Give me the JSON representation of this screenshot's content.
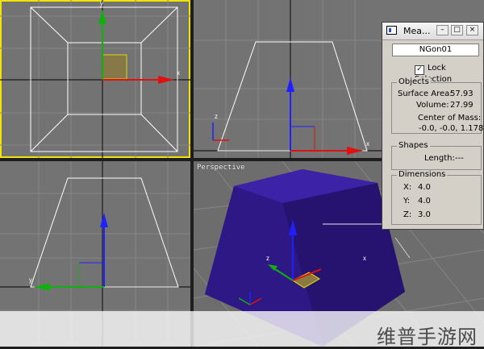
{
  "viewports": {
    "top": {
      "axis_x": "x",
      "axis_y": "y"
    },
    "front": {
      "axis_z": "z",
      "axis_x": "x"
    },
    "left": {
      "axis_y": "y"
    },
    "perspective": {
      "label": "Perspective",
      "axis_z": "z",
      "axis_y": "y",
      "axis_x": "x"
    }
  },
  "measure_dialog": {
    "title": "Mea...",
    "object_name": "NGon01",
    "lock_selection_label": "Lock Selection",
    "lock_selection_checked": true,
    "objects_group": {
      "title": "Objects",
      "surface_area_label": "Surface Area:",
      "surface_area_value": "57.93",
      "volume_label": "Volume:",
      "volume_value": "27.99",
      "center_of_mass_label": "Center of Mass:",
      "center_of_mass_value": "-0.0, -0.0, 1.178"
    },
    "shapes_group": {
      "title": "Shapes",
      "length_label": "Length:",
      "length_value": "---"
    },
    "dimensions_group": {
      "title": "Dimensions",
      "x_label": "X:",
      "x_value": "4.0",
      "y_label": "Y:",
      "y_value": "4.0",
      "z_label": "Z:",
      "z_value": "3.0"
    },
    "window_buttons": {
      "minimize": "–",
      "maximize": "□",
      "close": "×"
    }
  },
  "watermark": "维普手游网",
  "colors": {
    "viewport_bg": "#737373",
    "grid_line": "#868686",
    "axis_line": "#1a1a1a",
    "active_border": "#f2e400",
    "wireframe": "#ffffff",
    "object_fill": "#2f1a8c",
    "gizmo_x": "#e01010",
    "gizmo_y": "#10b010",
    "gizmo_z": "#2020ff"
  }
}
